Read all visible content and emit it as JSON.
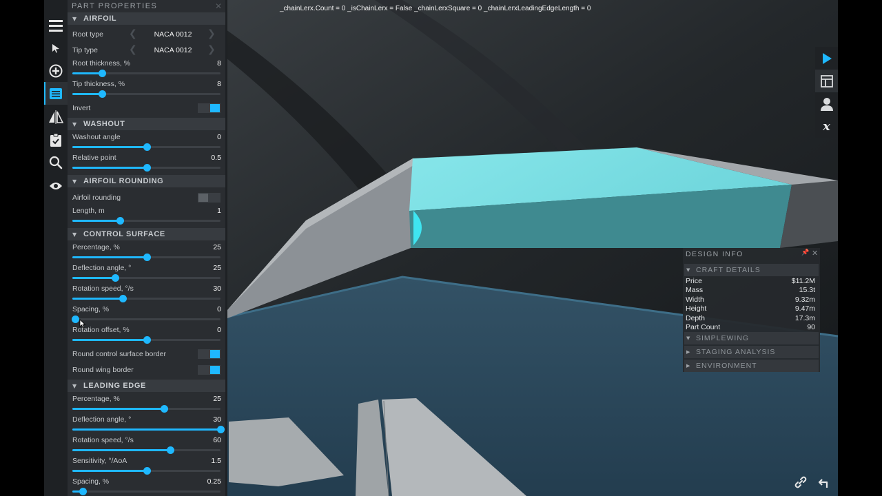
{
  "debug_text": "_chainLerx.Count = 0 _isChainLerx = False _chainLerxSquare = 0 _chainLerxLeadingEdgeLength = 0",
  "colors": {
    "accent": "#1fb8ff",
    "panel_bg": "#2a2d31",
    "section_bg": "#373b40",
    "wing_highlight": "#7fe0e6"
  },
  "toolbar": {
    "items": [
      {
        "name": "menu-icon"
      },
      {
        "name": "select-arrow-icon"
      },
      {
        "name": "add-part-icon"
      },
      {
        "name": "part-properties-icon",
        "active": true
      },
      {
        "name": "symmetry-icon"
      },
      {
        "name": "checklist-icon"
      },
      {
        "name": "search-icon"
      },
      {
        "name": "view-eye-icon"
      }
    ]
  },
  "part_properties": {
    "title": "PART PROPERTIES",
    "airfoil": {
      "header": "AIRFOIL",
      "root_type": {
        "label": "Root type",
        "value": "NACA 0012"
      },
      "tip_type": {
        "label": "Tip type",
        "value": "NACA 0012"
      },
      "root_thickness": {
        "label": "Root thickness, %",
        "value": "8",
        "fraction": 0.2
      },
      "tip_thickness": {
        "label": "Tip thickness, %",
        "value": "8",
        "fraction": 0.2
      },
      "invert": {
        "label": "Invert",
        "on": true
      }
    },
    "washout": {
      "header": "WASHOUT",
      "washout_angle": {
        "label": "Washout angle",
        "value": "0",
        "fraction": 0.5
      },
      "relative_point": {
        "label": "Relative point",
        "value": "0.5",
        "fraction": 0.5
      }
    },
    "airfoil_rounding": {
      "header": "AIRFOIL ROUNDING",
      "airfoil_rounding": {
        "label": "Airfoil rounding",
        "on": false
      },
      "length": {
        "label": "Length, m",
        "value": "1",
        "fraction": 0.32
      }
    },
    "control_surface": {
      "header": "CONTROL SURFACE",
      "percentage": {
        "label": "Percentage, %",
        "value": "25",
        "fraction": 0.5
      },
      "deflection_angle": {
        "label": "Deflection angle, °",
        "value": "25",
        "fraction": 0.29
      },
      "rotation_speed": {
        "label": "Rotation speed, °/s",
        "value": "30",
        "fraction": 0.34
      },
      "spacing": {
        "label": "Spacing, %",
        "value": "0",
        "fraction": 0.02
      },
      "rotation_offset": {
        "label": "Rotation offset, %",
        "value": "0",
        "fraction": 0.5
      },
      "round_control_surface_border": {
        "label": "Round control surface border",
        "on": true
      },
      "round_wing_border": {
        "label": "Round wing border",
        "on": true
      }
    },
    "leading_edge": {
      "header": "LEADING EDGE",
      "percentage": {
        "label": "Percentage, %",
        "value": "25",
        "fraction": 0.62
      },
      "deflection_angle": {
        "label": "Deflection angle, °",
        "value": "30",
        "fraction": 1.0
      },
      "rotation_speed": {
        "label": "Rotation speed, °/s",
        "value": "60",
        "fraction": 0.66
      },
      "sensitivity": {
        "label": "Sensitivity, °/AoA",
        "value": "1.5",
        "fraction": 0.5
      },
      "spacing": {
        "label": "Spacing, %",
        "value": "0.25",
        "fraction": 0.07
      }
    }
  },
  "right_toolbar": {
    "items": [
      {
        "name": "play-icon"
      },
      {
        "name": "layout-panel-icon",
        "active": true
      },
      {
        "name": "user-icon"
      },
      {
        "name": "variable-x-icon"
      }
    ]
  },
  "design_info": {
    "title": "DESIGN INFO",
    "craft_details_header": "CRAFT DETAILS",
    "rows": [
      {
        "label": "Price",
        "value": "$11.2M"
      },
      {
        "label": "Mass",
        "value": "15.3t"
      },
      {
        "label": "Width",
        "value": "9.32m"
      },
      {
        "label": "Height",
        "value": "9.47m"
      },
      {
        "label": "Depth",
        "value": "17.3m"
      },
      {
        "label": "Part Count",
        "value": "90"
      }
    ],
    "sections": [
      "SIMPLEWING",
      "STAGING ANALYSIS",
      "ENVIRONMENT"
    ]
  },
  "bottom_icons": [
    {
      "name": "link-icon"
    },
    {
      "name": "undo-icon"
    }
  ]
}
